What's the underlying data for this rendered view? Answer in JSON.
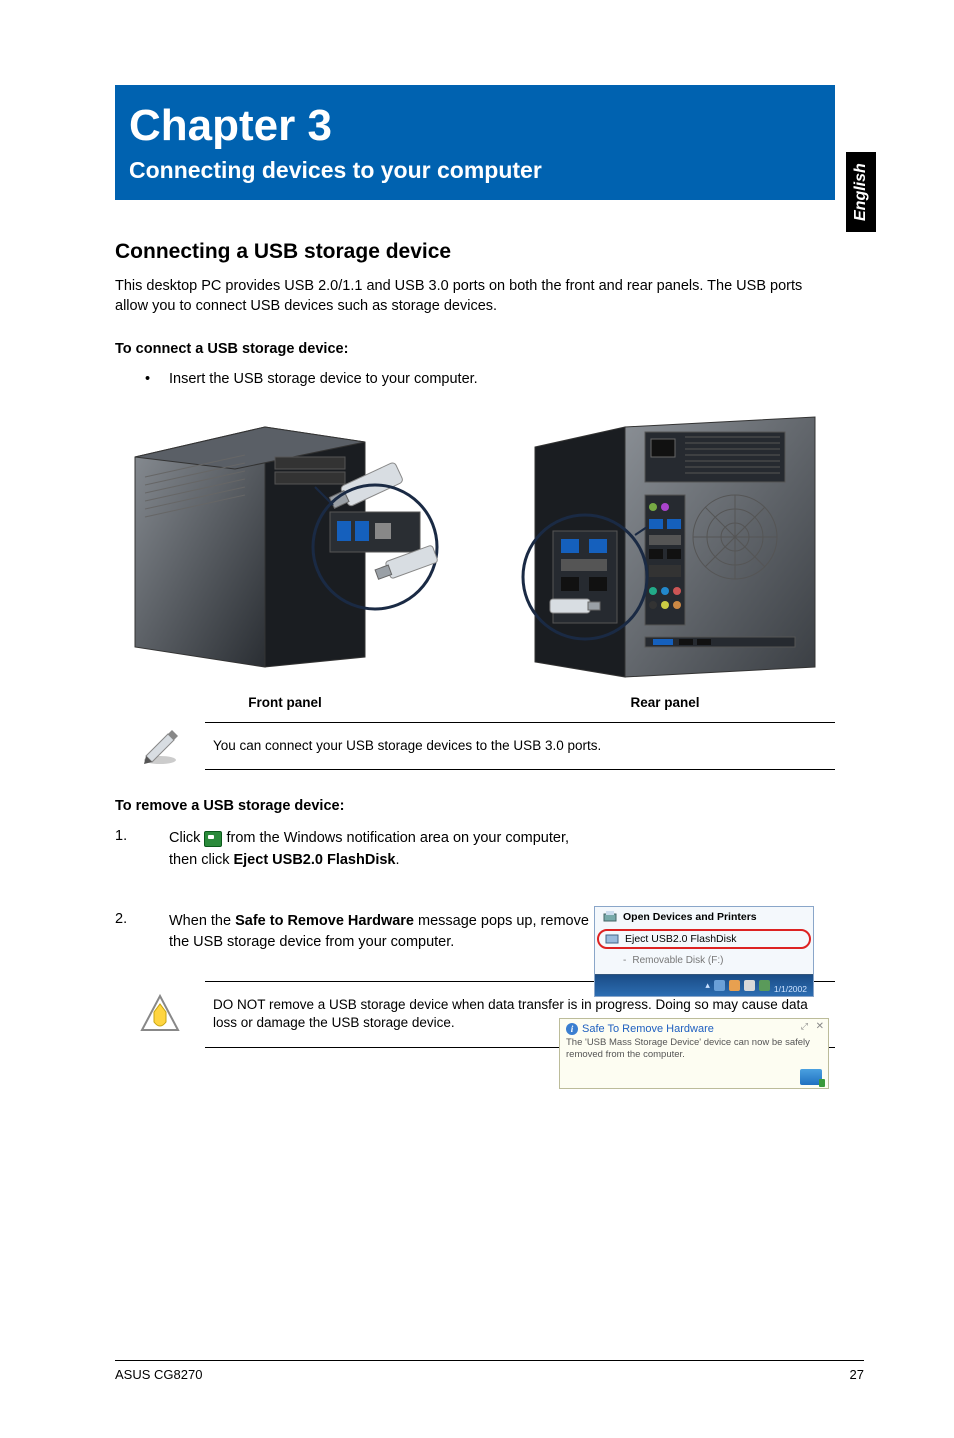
{
  "lang_tab": "English",
  "chapter": {
    "title": "Chapter 3",
    "subtitle": "Connecting devices to your computer"
  },
  "section": {
    "heading": "Connecting a USB storage device",
    "intro": "This desktop PC provides USB 2.0/1.1 and USB 3.0 ports on both the front and rear panels. The USB ports allow you to connect USB devices such as storage devices.",
    "connect_heading": "To connect a USB storage device:",
    "connect_bullet": "Insert the USB storage device to your computer.",
    "front_caption": "Front panel",
    "rear_caption": "Rear panel",
    "note1": "You can connect your USB storage devices to the USB 3.0 ports.",
    "remove_heading": "To remove a USB storage device:",
    "step1_pre": "Click ",
    "step1_post": " from the Windows notification area on your computer, then click ",
    "step1_bold": "Eject USB2.0 FlashDisk",
    "step1_end": ".",
    "step2_pre": "When the ",
    "step2_bold": "Safe to Remove Hardware",
    "step2_post": " message pops up, remove the USB storage device from your computer.",
    "warn": "DO NOT remove a USB storage device when data transfer is in progress. Doing so may cause data loss or damage the USB storage device."
  },
  "popup_eject": {
    "open_devices": "Open Devices and Printers",
    "eject": "Eject USB2.0 FlashDisk",
    "removable": "Removable Disk (F:)",
    "time": "1/1/2002"
  },
  "popup_safe": {
    "title": "Safe To Remove Hardware",
    "msg": "The 'USB Mass Storage Device' device can now be safely removed from the computer."
  },
  "footer": {
    "model": "ASUS CG8270",
    "page": "27"
  }
}
